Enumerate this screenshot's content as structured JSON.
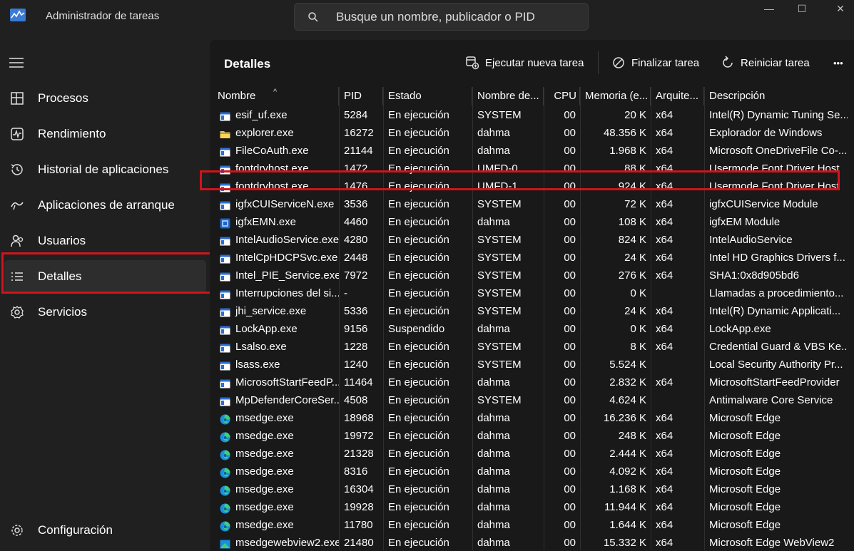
{
  "app": {
    "title": "Administrador de tareas",
    "search_placeholder": "Busque un nombre, publicador o PID",
    "controls": {
      "minimize": "—",
      "maximize": "☐",
      "close": "✕"
    }
  },
  "sidebar": {
    "items": [
      {
        "label": "Procesos",
        "icon": "processes-icon"
      },
      {
        "label": "Rendimiento",
        "icon": "performance-icon"
      },
      {
        "label": "Historial de aplicaciones",
        "icon": "history-icon"
      },
      {
        "label": "Aplicaciones de arranque",
        "icon": "startup-icon"
      },
      {
        "label": "Usuarios",
        "icon": "users-icon"
      },
      {
        "label": "Detalles",
        "icon": "details-icon"
      },
      {
        "label": "Servicios",
        "icon": "services-icon"
      }
    ],
    "active": "Detalles",
    "settings_label": "Configuración"
  },
  "toolbar": {
    "title": "Detalles",
    "run_task": "Ejecutar nueva tarea",
    "end_task": "Finalizar tarea",
    "restart_task": "Reiniciar tarea",
    "more": "•••"
  },
  "table": {
    "headers": [
      "Nombre",
      "PID",
      "Estado",
      "Nombre de...",
      "CPU",
      "Memoria (e...",
      "Arquite...",
      "Descripción"
    ],
    "rows": [
      {
        "icon": "app-icon",
        "name": "esif_uf.exe",
        "pid": "5284",
        "status": "En ejecución",
        "user": "SYSTEM",
        "cpu": "00",
        "mem": "20 K",
        "arch": "x64",
        "desc": "Intel(R) Dynamic Tuning Se..."
      },
      {
        "icon": "folder-icon",
        "name": "explorer.exe",
        "pid": "16272",
        "status": "En ejecución",
        "user": "dahma",
        "cpu": "00",
        "mem": "48.356 K",
        "arch": "x64",
        "desc": "Explorador de Windows"
      },
      {
        "icon": "app-icon",
        "name": "FileCoAuth.exe",
        "pid": "21144",
        "status": "En ejecución",
        "user": "dahma",
        "cpu": "00",
        "mem": "1.968 K",
        "arch": "x64",
        "desc": "Microsoft OneDriveFile Co-..."
      },
      {
        "icon": "app-icon",
        "name": "fontdrvhost.exe",
        "pid": "1472",
        "status": "En ejecución",
        "user": "UMFD-0",
        "cpu": "00",
        "mem": "88 K",
        "arch": "x64",
        "desc": "Usermode Font Driver Host"
      },
      {
        "icon": "app-icon",
        "name": "fontdrvhost.exe",
        "pid": "1476",
        "status": "En ejecución",
        "user": "UMFD-1",
        "cpu": "00",
        "mem": "924 K",
        "arch": "x64",
        "desc": "Usermode Font Driver Host"
      },
      {
        "icon": "app-icon",
        "name": "igfxCUIServiceN.exe",
        "pid": "3536",
        "status": "En ejecución",
        "user": "SYSTEM",
        "cpu": "00",
        "mem": "72 K",
        "arch": "x64",
        "desc": "igfxCUIService Module"
      },
      {
        "icon": "igfx-icon",
        "name": "igfxEMN.exe",
        "pid": "4460",
        "status": "En ejecución",
        "user": "dahma",
        "cpu": "00",
        "mem": "108 K",
        "arch": "x64",
        "desc": "igfxEM Module"
      },
      {
        "icon": "app-icon",
        "name": "IntelAudioService.exe",
        "pid": "4280",
        "status": "En ejecución",
        "user": "SYSTEM",
        "cpu": "00",
        "mem": "824 K",
        "arch": "x64",
        "desc": "IntelAudioService"
      },
      {
        "icon": "app-icon",
        "name": "IntelCpHDCPSvc.exe",
        "pid": "2448",
        "status": "En ejecución",
        "user": "SYSTEM",
        "cpu": "00",
        "mem": "24 K",
        "arch": "x64",
        "desc": "Intel HD Graphics Drivers f..."
      },
      {
        "icon": "app-icon",
        "name": "Intel_PIE_Service.exe",
        "pid": "7972",
        "status": "En ejecución",
        "user": "SYSTEM",
        "cpu": "00",
        "mem": "276 K",
        "arch": "x64",
        "desc": "SHA1:0x8d905bd6"
      },
      {
        "icon": "app-icon",
        "name": "Interrupciones del si...",
        "pid": "-",
        "status": "En ejecución",
        "user": "SYSTEM",
        "cpu": "00",
        "mem": "0 K",
        "arch": "",
        "desc": "Llamadas a procedimiento..."
      },
      {
        "icon": "app-icon",
        "name": "jhi_service.exe",
        "pid": "5336",
        "status": "En ejecución",
        "user": "SYSTEM",
        "cpu": "00",
        "mem": "24 K",
        "arch": "x64",
        "desc": "Intel(R) Dynamic Applicati..."
      },
      {
        "icon": "app-icon",
        "name": "LockApp.exe",
        "pid": "9156",
        "status": "Suspendido",
        "user": "dahma",
        "cpu": "00",
        "mem": "0 K",
        "arch": "x64",
        "desc": "LockApp.exe"
      },
      {
        "icon": "app-icon",
        "name": "Lsalso.exe",
        "pid": "1228",
        "status": "En ejecución",
        "user": "SYSTEM",
        "cpu": "00",
        "mem": "8 K",
        "arch": "x64",
        "desc": "Credential Guard & VBS Ke..."
      },
      {
        "icon": "app-icon",
        "name": "lsass.exe",
        "pid": "1240",
        "status": "En ejecución",
        "user": "SYSTEM",
        "cpu": "00",
        "mem": "5.524 K",
        "arch": "",
        "desc": "Local Security Authority Pr..."
      },
      {
        "icon": "app-icon",
        "name": "MicrosoftStartFeedP...",
        "pid": "11464",
        "status": "En ejecución",
        "user": "dahma",
        "cpu": "00",
        "mem": "2.832 K",
        "arch": "x64",
        "desc": "MicrosoftStartFeedProvider"
      },
      {
        "icon": "app-icon",
        "name": "MpDefenderCoreSer...",
        "pid": "4508",
        "status": "En ejecución",
        "user": "SYSTEM",
        "cpu": "00",
        "mem": "4.624 K",
        "arch": "",
        "desc": "Antimalware Core Service"
      },
      {
        "icon": "edge-icon",
        "name": "msedge.exe",
        "pid": "18968",
        "status": "En ejecución",
        "user": "dahma",
        "cpu": "00",
        "mem": "16.236 K",
        "arch": "x64",
        "desc": "Microsoft Edge"
      },
      {
        "icon": "edge-icon",
        "name": "msedge.exe",
        "pid": "19972",
        "status": "En ejecución",
        "user": "dahma",
        "cpu": "00",
        "mem": "248 K",
        "arch": "x64",
        "desc": "Microsoft Edge"
      },
      {
        "icon": "edge-icon",
        "name": "msedge.exe",
        "pid": "21328",
        "status": "En ejecución",
        "user": "dahma",
        "cpu": "00",
        "mem": "2.444 K",
        "arch": "x64",
        "desc": "Microsoft Edge"
      },
      {
        "icon": "edge-icon",
        "name": "msedge.exe",
        "pid": "8316",
        "status": "En ejecución",
        "user": "dahma",
        "cpu": "00",
        "mem": "4.092 K",
        "arch": "x64",
        "desc": "Microsoft Edge"
      },
      {
        "icon": "edge-icon",
        "name": "msedge.exe",
        "pid": "16304",
        "status": "En ejecución",
        "user": "dahma",
        "cpu": "00",
        "mem": "1.168 K",
        "arch": "x64",
        "desc": "Microsoft Edge"
      },
      {
        "icon": "edge-icon",
        "name": "msedge.exe",
        "pid": "19928",
        "status": "En ejecución",
        "user": "dahma",
        "cpu": "00",
        "mem": "11.944 K",
        "arch": "x64",
        "desc": "Microsoft Edge"
      },
      {
        "icon": "edge-icon",
        "name": "msedge.exe",
        "pid": "11780",
        "status": "En ejecución",
        "user": "dahma",
        "cpu": "00",
        "mem": "1.644 K",
        "arch": "x64",
        "desc": "Microsoft Edge"
      },
      {
        "icon": "webview-icon",
        "name": "msedgewebview2.exe",
        "pid": "21480",
        "status": "En ejecución",
        "user": "dahma",
        "cpu": "00",
        "mem": "15.332 K",
        "arch": "x64",
        "desc": "Microsoft Edge WebView2"
      }
    ],
    "highlighted_row": "explorer.exe"
  },
  "colors": {
    "background": "#202020",
    "panel": "#191919",
    "active_nav": "#2d2d2d",
    "highlight_border": "#d1141b",
    "text": "#ffffff"
  }
}
